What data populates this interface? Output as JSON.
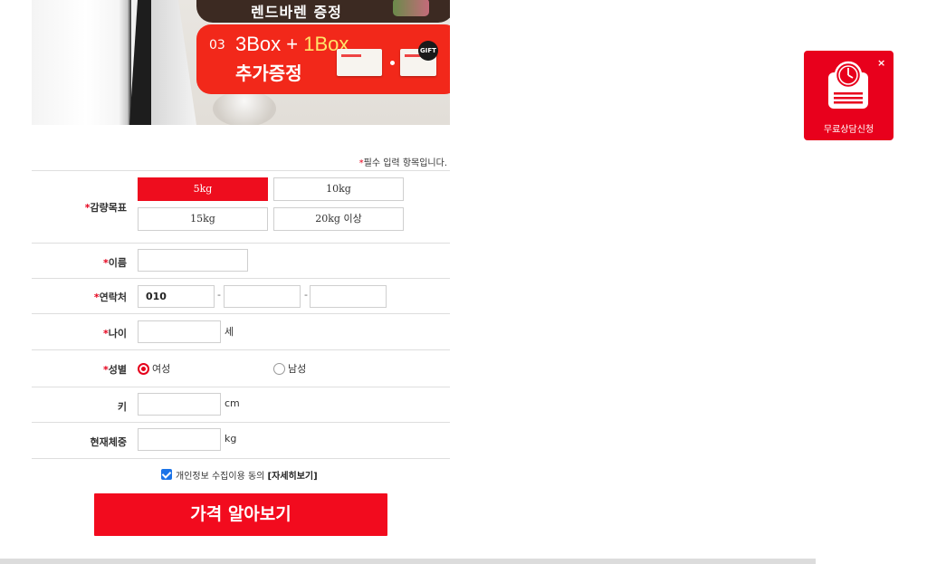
{
  "banner": {
    "top_text": "렌드바렌 증정",
    "item_number": "03",
    "offer_line1_part1": "3Box + ",
    "offer_line1_part2": "1Box",
    "offer_line2": "추가증정",
    "gift_badge": "GIFT"
  },
  "form": {
    "required_note": "필수 입력 항목입니다.",
    "required_mark": "*",
    "goal": {
      "label": "감량목표",
      "options": [
        "5kg",
        "10kg",
        "15kg",
        "20kg 이상"
      ],
      "selected": "5kg"
    },
    "name": {
      "label": "이름",
      "value": ""
    },
    "phone": {
      "label": "연락처",
      "prefix": "010",
      "part2": "",
      "part3": "",
      "separator": "-"
    },
    "age": {
      "label": "나이",
      "value": "",
      "unit": "세"
    },
    "gender": {
      "label": "성별",
      "options": [
        "여성",
        "남성"
      ],
      "selected": "여성"
    },
    "height": {
      "label": "키",
      "value": "",
      "unit": "cm"
    },
    "weight": {
      "label": "현재체중",
      "value": "",
      "unit": "kg"
    },
    "consent": {
      "text": "개인정보 수집이용 동의 ",
      "link": "[자세히보기]",
      "checked": true
    },
    "submit_label": "가격 알아보기"
  },
  "floating_widget": {
    "label": "무료상담신청",
    "close": "×",
    "icon": "scale-clock-icon"
  },
  "colors": {
    "accent_red": "#ee0d1e",
    "banner_red": "#f2281a",
    "banner_brown": "#3c2a22",
    "checkbox_blue": "#1a73e8"
  }
}
